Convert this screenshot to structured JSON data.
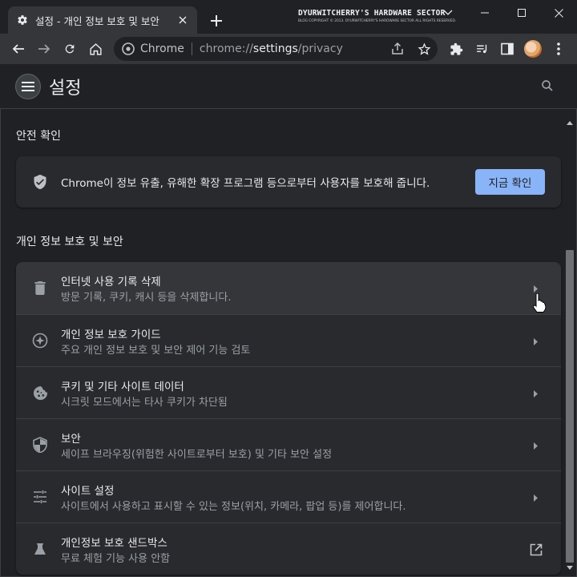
{
  "browser": {
    "tab_title": "설정 - 개인 정보 보호 및 보안",
    "watermark_title": "DYURWITCHERRY'S HARDWARE SECTOR",
    "watermark_sub": "BLOG COPYRIGHT © 2013. DYURWITCHERRY'S HARDWARE SECTOR ALL RIGHTS RESERVED.",
    "omnibox": {
      "chip": "Chrome",
      "url_scheme": "chrome://",
      "url_host": "settings",
      "url_path": "/privacy"
    }
  },
  "header": {
    "title": "설정"
  },
  "safety_check": {
    "section_title": "안전 확인",
    "text": "Chrome이 정보 유출, 유해한 확장 프로그램 등으로부터 사용자를 보호해 줍니다.",
    "button": "지금 확인"
  },
  "privacy": {
    "section_title": "개인 정보 보호 및 보안",
    "items": [
      {
        "title": "인터넷 사용 기록 삭제",
        "subtitle": "방문 기록, 쿠키, 캐시 등을 삭제합니다.",
        "icon": "trash-icon"
      },
      {
        "title": "개인 정보 보호 가이드",
        "subtitle": "주요 개인 정보 보호 및 보안 제어 기능 검토",
        "icon": "compass-icon"
      },
      {
        "title": "쿠키 및 기타 사이트 데이터",
        "subtitle": "시크릿 모드에서는 타사 쿠키가 차단됨",
        "icon": "cookie-icon"
      },
      {
        "title": "보안",
        "subtitle": "세이프 브라우징(위험한 사이트로부터 보호) 및 기타 보안 설정",
        "icon": "security-shield-icon"
      },
      {
        "title": "사이트 설정",
        "subtitle": "사이트에서 사용하고 표시할 수 있는 정보(위치, 카메라, 팝업 등)를 제어합니다.",
        "icon": "tune-icon"
      },
      {
        "title": "개인정보 보호 샌드박스",
        "subtitle": "무료 체험 기능 사용 안함",
        "icon": "flask-icon"
      }
    ]
  },
  "colors": {
    "accent": "#8ab4f8",
    "background": "#202124",
    "card": "#292a2d"
  }
}
